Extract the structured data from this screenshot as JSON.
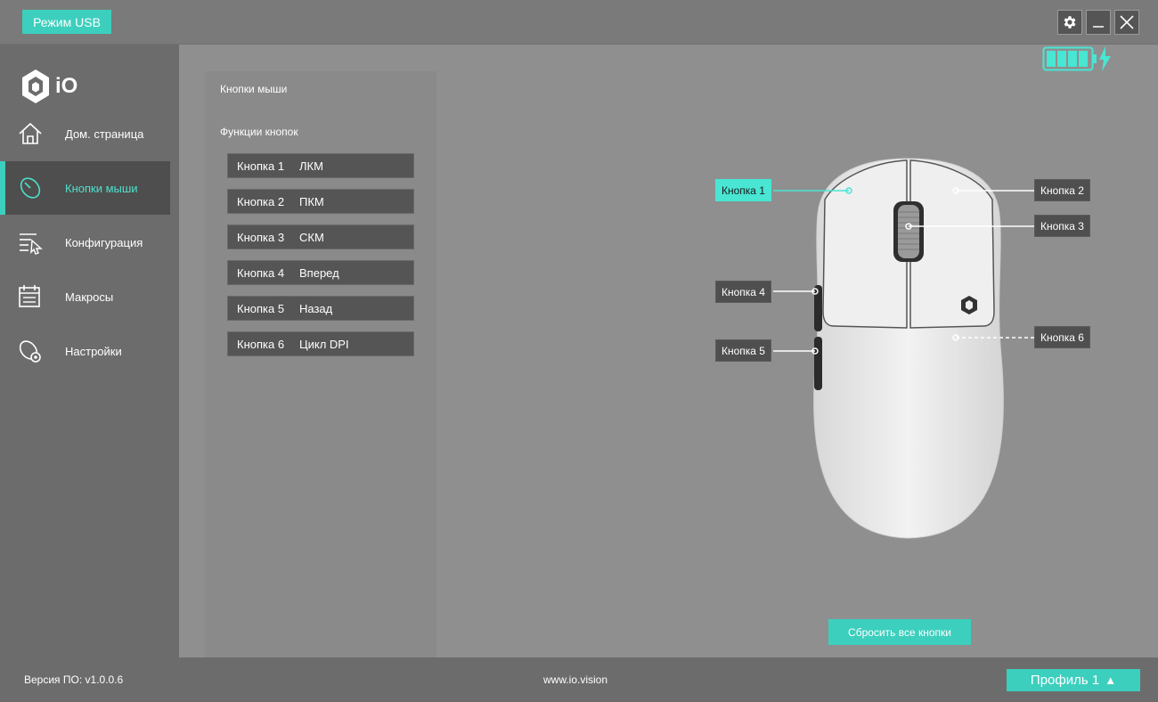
{
  "titlebar": {
    "usb_mode": "Режим USB"
  },
  "icons": {
    "settings": "gear-icon",
    "minimize": "minimize-icon",
    "close": "close-icon",
    "battery": "battery-icon",
    "charging": "lightning-icon"
  },
  "logo": {
    "text": "iO"
  },
  "sidebar": {
    "items": [
      {
        "label": "Дом. страница",
        "icon": "home-icon",
        "active": false
      },
      {
        "label": "Кнопки мыши",
        "icon": "mouse-icon",
        "active": true
      },
      {
        "label": "Конфигурация",
        "icon": "config-icon",
        "active": false
      },
      {
        "label": "Макросы",
        "icon": "macro-icon",
        "active": false
      },
      {
        "label": "Настройки",
        "icon": "settings-icon",
        "active": false
      }
    ]
  },
  "panel": {
    "title": "Кнопки мыши",
    "subtitle": "Функции кнопок",
    "buttons": [
      {
        "name": "Кнопка 1",
        "function": "ЛКМ"
      },
      {
        "name": "Кнопка 2",
        "function": "ПКМ"
      },
      {
        "name": "Кнопка 3",
        "function": "СКМ"
      },
      {
        "name": "Кнопка 4",
        "function": "Вперед"
      },
      {
        "name": "Кнопка 5",
        "function": "Назад"
      },
      {
        "name": "Кнопка 6",
        "function": "Цикл DPI"
      }
    ]
  },
  "mouse_callouts": {
    "b1": "Кнопка 1",
    "b2": "Кнопка 2",
    "b3": "Кнопка 3",
    "b4": "Кнопка 4",
    "b5": "Кнопка 5",
    "b6": "Кнопка 6"
  },
  "actions": {
    "reset_all": "Сбросить все кнопки"
  },
  "footer": {
    "version": "Версия ПО: v1.0.0.6",
    "site": "www.io.vision",
    "profile": "Профиль 1"
  },
  "colors": {
    "accent": "#3ccfbd",
    "active_text": "#4fe0cc",
    "sidebar_bg": "#6c6c6c",
    "main_bg": "#8f8f8f"
  }
}
